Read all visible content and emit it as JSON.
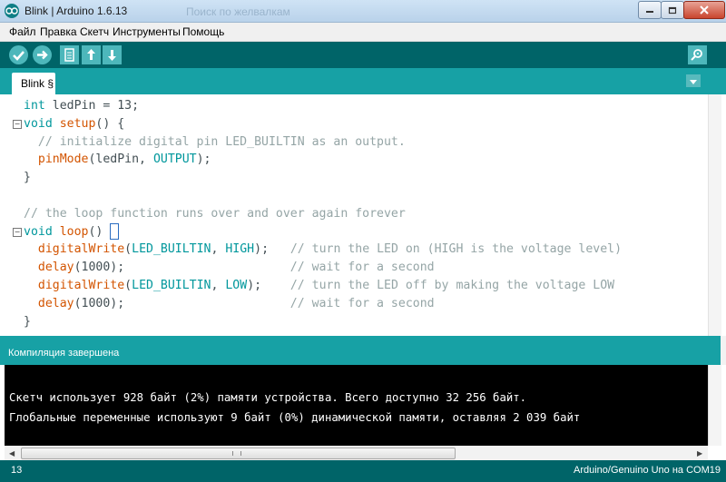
{
  "window": {
    "title": "Blink | Arduino 1.6.13",
    "ghost_title": "Поиск по желвалкам"
  },
  "menu": [
    "Файл",
    "Правка",
    "Скетч",
    "Инструменты",
    "Помощь"
  ],
  "toolbar": {
    "icons": [
      "verify-icon",
      "upload-icon",
      "new-icon",
      "open-icon",
      "save-icon",
      "serial-monitor-icon"
    ]
  },
  "tabs": [
    {
      "label": "Blink §"
    }
  ],
  "editor": {
    "lines": [
      {
        "segments": [
          {
            "t": "int",
            "c": "type"
          },
          {
            "t": " ledPin = 13;",
            "c": ""
          }
        ],
        "fold": false
      },
      {
        "segments": [
          {
            "t": "void",
            "c": "type"
          },
          {
            "t": " ",
            "c": ""
          },
          {
            "t": "setup",
            "c": "fn"
          },
          {
            "t": "() {",
            "c": ""
          }
        ],
        "fold": true
      },
      {
        "segments": [
          {
            "t": "  // initialize digital pin LED_BUILTIN as an output.",
            "c": "cmt"
          }
        ],
        "fold": false
      },
      {
        "segments": [
          {
            "t": "  ",
            "c": ""
          },
          {
            "t": "pinMode",
            "c": "fn"
          },
          {
            "t": "(ledPin, ",
            "c": ""
          },
          {
            "t": "OUTPUT",
            "c": "const"
          },
          {
            "t": ");",
            "c": ""
          }
        ],
        "fold": false
      },
      {
        "segments": [
          {
            "t": "}",
            "c": ""
          }
        ],
        "fold": false
      },
      {
        "segments": [
          {
            "t": "",
            "c": ""
          }
        ],
        "fold": false
      },
      {
        "segments": [
          {
            "t": "// the loop function runs over and over again forever",
            "c": "cmt"
          }
        ],
        "fold": false
      },
      {
        "segments": [
          {
            "t": "void",
            "c": "type"
          },
          {
            "t": " ",
            "c": ""
          },
          {
            "t": "loop",
            "c": "fn"
          },
          {
            "t": "() ",
            "c": ""
          }
        ],
        "fold": true,
        "cursor": true
      },
      {
        "segments": [
          {
            "t": "  ",
            "c": ""
          },
          {
            "t": "digitalWrite",
            "c": "fn"
          },
          {
            "t": "(",
            "c": ""
          },
          {
            "t": "LED_BUILTIN",
            "c": "const"
          },
          {
            "t": ", ",
            "c": ""
          },
          {
            "t": "HIGH",
            "c": "const"
          },
          {
            "t": ");   ",
            "c": ""
          },
          {
            "t": "// turn the LED on (HIGH is the voltage level)",
            "c": "cmt"
          }
        ],
        "fold": false
      },
      {
        "segments": [
          {
            "t": "  ",
            "c": ""
          },
          {
            "t": "delay",
            "c": "fn"
          },
          {
            "t": "(1000);                       ",
            "c": ""
          },
          {
            "t": "// wait for a second",
            "c": "cmt"
          }
        ],
        "fold": false
      },
      {
        "segments": [
          {
            "t": "  ",
            "c": ""
          },
          {
            "t": "digitalWrite",
            "c": "fn"
          },
          {
            "t": "(",
            "c": ""
          },
          {
            "t": "LED_BUILTIN",
            "c": "const"
          },
          {
            "t": ", ",
            "c": ""
          },
          {
            "t": "LOW",
            "c": "const"
          },
          {
            "t": ");    ",
            "c": ""
          },
          {
            "t": "// turn the LED off by making the voltage LOW",
            "c": "cmt"
          }
        ],
        "fold": false
      },
      {
        "segments": [
          {
            "t": "  ",
            "c": ""
          },
          {
            "t": "delay",
            "c": "fn"
          },
          {
            "t": "(1000);                       ",
            "c": ""
          },
          {
            "t": "// wait for a second",
            "c": "cmt"
          }
        ],
        "fold": false
      },
      {
        "segments": [
          {
            "t": "}",
            "c": ""
          }
        ],
        "fold": false
      }
    ]
  },
  "status": {
    "message": "Компиляция завершена"
  },
  "console": {
    "lines": [
      "Скетч использует 928 байт (2%) памяти устройства. Всего доступно 32 256 байт.",
      "Глобальные переменные используют 9 байт (0%) динамической памяти, оставляя 2 039 байт"
    ]
  },
  "footer": {
    "line_number": "13",
    "board": "Arduino/Genuino Uno на COM19"
  },
  "colors": {
    "dark_teal": "#006468",
    "teal": "#17a1a5",
    "keyword": "#00979c",
    "function": "#d35400",
    "comment": "#95a5a6",
    "text": "#434f54"
  }
}
